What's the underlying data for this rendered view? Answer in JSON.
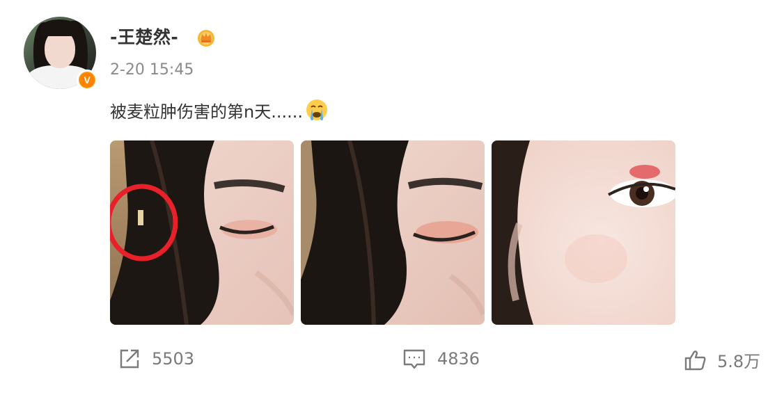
{
  "post": {
    "username": "-王楚然-",
    "time": "2-20 15:45",
    "text": "被麦粒肿伤害的第n天......",
    "emoji": "crying-face-emoji",
    "verified_badge": "V",
    "vip_icon": "crown-badge-icon",
    "images": [
      {
        "name": "photo-1",
        "annotation": "red-circle"
      },
      {
        "name": "photo-2"
      },
      {
        "name": "photo-3"
      }
    ]
  },
  "actions": {
    "repost_count": "5503",
    "comment_count": "4836",
    "like_count": "5.8万"
  },
  "colors": {
    "text": "#333333",
    "muted": "#8a8a8a",
    "action": "#7a7a7a",
    "badge": "#ff8200",
    "annotation": "#e8202a"
  }
}
